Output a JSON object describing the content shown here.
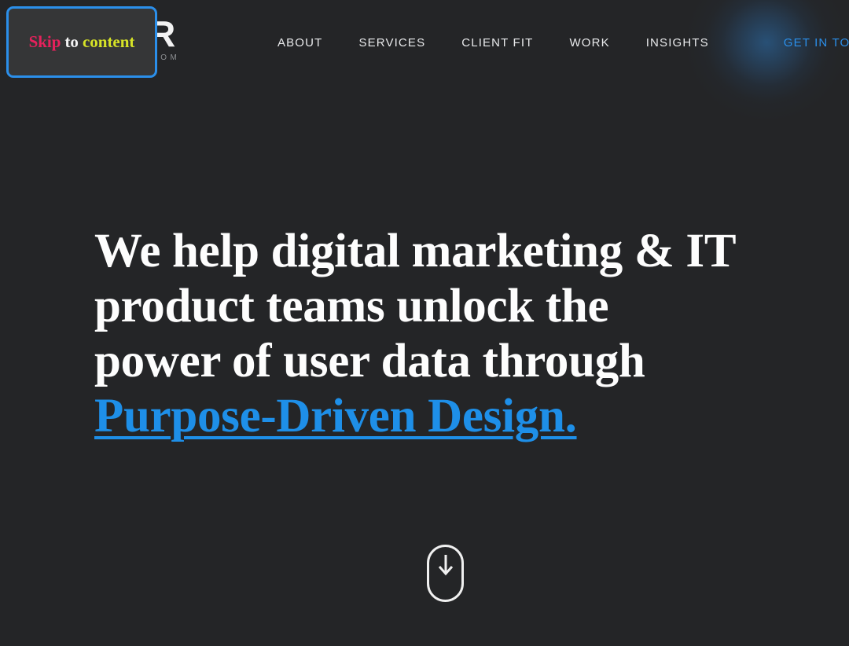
{
  "page": {
    "background_color": "#242527"
  },
  "skip_link": {
    "name": "Skip to content",
    "word_1": "Skip",
    "word_2": "to",
    "word_3": "content",
    "word_1_color": "#e6215c",
    "word_2_color": "#f4f4f4",
    "word_3_color": "#d6e327",
    "focus_border_color": "#2b8fea",
    "background_color": "#353637",
    "focused": true
  },
  "header": {
    "brand": {
      "mark": "R",
      "subtitle": "OOM",
      "mark_color": "#f2f2f2",
      "subtitle_color": "#8d8f92"
    },
    "nav": {
      "items": [
        {
          "label": "ABOUT",
          "kind": "link"
        },
        {
          "label": "SERVICES",
          "kind": "link"
        },
        {
          "label": "CLIENT FIT",
          "kind": "link"
        },
        {
          "label": "WORK",
          "kind": "link"
        },
        {
          "label": "INSIGHTS",
          "kind": "link"
        },
        {
          "label": "GET IN TOUCH",
          "kind": "cta"
        }
      ],
      "link_color": "#e9eaec",
      "cta_color": "#2b8fea",
      "cta_glow_color": "#2d78be"
    }
  },
  "hero": {
    "headline": {
      "line_1": "We help digital marketing & IT",
      "line_2": "product teams unlock the",
      "line_3": "power of user data through",
      "line_4_link": "Purpose-Driven Design.",
      "text_color": "#fdfdfd",
      "link_color": "#1e8fe8"
    },
    "scroll_indicator": {
      "icon": "mouse-scroll-down-icon",
      "stroke_color": "#f0f0f0"
    }
  }
}
